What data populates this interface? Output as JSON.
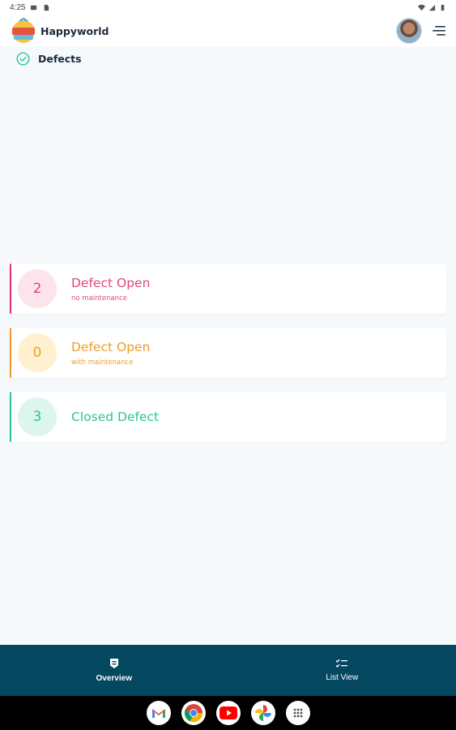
{
  "status_bar": {
    "time": "4:25"
  },
  "header": {
    "app_name": "Happyworld",
    "logo_icon": "happyworld-logo",
    "avatar_icon": "user-avatar",
    "menu_icon": "hamburger-menu-icon"
  },
  "section": {
    "title": "Defects",
    "icon": "check-circle-icon"
  },
  "cards": [
    {
      "count": "2",
      "title": "Defect Open",
      "subtitle": "no maintenance",
      "accent": "#e0316f"
    },
    {
      "count": "0",
      "title": "Defect Open",
      "subtitle": "with maintenance",
      "accent": "#f09a2b"
    },
    {
      "count": "3",
      "title": "Closed Defect",
      "subtitle": "",
      "accent": "#27c49b"
    }
  ],
  "bottom_nav": {
    "items": [
      {
        "label": "Overview",
        "icon": "shield-badge-icon",
        "active": true
      },
      {
        "label": "List View",
        "icon": "checklist-icon",
        "active": false
      }
    ]
  },
  "dock": {
    "apps": [
      "gmail-icon",
      "chrome-icon",
      "youtube-icon",
      "photos-icon",
      "app-drawer-icon"
    ]
  },
  "colors": {
    "header_bg": "#ffffff",
    "page_bg": "#f5f9fc",
    "nav_bg": "#044860"
  }
}
